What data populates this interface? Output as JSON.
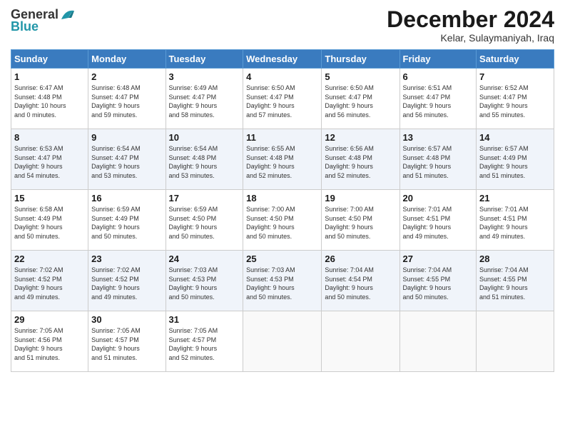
{
  "header": {
    "logo_general": "General",
    "logo_blue": "Blue",
    "month_title": "December 2024",
    "location": "Kelar, Sulaymaniyah, Iraq"
  },
  "calendar": {
    "days_of_week": [
      "Sunday",
      "Monday",
      "Tuesday",
      "Wednesday",
      "Thursday",
      "Friday",
      "Saturday"
    ],
    "weeks": [
      [
        {
          "day": "1",
          "info": "Sunrise: 6:47 AM\nSunset: 4:48 PM\nDaylight: 10 hours\nand 0 minutes."
        },
        {
          "day": "2",
          "info": "Sunrise: 6:48 AM\nSunset: 4:47 PM\nDaylight: 9 hours\nand 59 minutes."
        },
        {
          "day": "3",
          "info": "Sunrise: 6:49 AM\nSunset: 4:47 PM\nDaylight: 9 hours\nand 58 minutes."
        },
        {
          "day": "4",
          "info": "Sunrise: 6:50 AM\nSunset: 4:47 PM\nDaylight: 9 hours\nand 57 minutes."
        },
        {
          "day": "5",
          "info": "Sunrise: 6:50 AM\nSunset: 4:47 PM\nDaylight: 9 hours\nand 56 minutes."
        },
        {
          "day": "6",
          "info": "Sunrise: 6:51 AM\nSunset: 4:47 PM\nDaylight: 9 hours\nand 56 minutes."
        },
        {
          "day": "7",
          "info": "Sunrise: 6:52 AM\nSunset: 4:47 PM\nDaylight: 9 hours\nand 55 minutes."
        }
      ],
      [
        {
          "day": "8",
          "info": "Sunrise: 6:53 AM\nSunset: 4:47 PM\nDaylight: 9 hours\nand 54 minutes."
        },
        {
          "day": "9",
          "info": "Sunrise: 6:54 AM\nSunset: 4:47 PM\nDaylight: 9 hours\nand 53 minutes."
        },
        {
          "day": "10",
          "info": "Sunrise: 6:54 AM\nSunset: 4:48 PM\nDaylight: 9 hours\nand 53 minutes."
        },
        {
          "day": "11",
          "info": "Sunrise: 6:55 AM\nSunset: 4:48 PM\nDaylight: 9 hours\nand 52 minutes."
        },
        {
          "day": "12",
          "info": "Sunrise: 6:56 AM\nSunset: 4:48 PM\nDaylight: 9 hours\nand 52 minutes."
        },
        {
          "day": "13",
          "info": "Sunrise: 6:57 AM\nSunset: 4:48 PM\nDaylight: 9 hours\nand 51 minutes."
        },
        {
          "day": "14",
          "info": "Sunrise: 6:57 AM\nSunset: 4:49 PM\nDaylight: 9 hours\nand 51 minutes."
        }
      ],
      [
        {
          "day": "15",
          "info": "Sunrise: 6:58 AM\nSunset: 4:49 PM\nDaylight: 9 hours\nand 50 minutes."
        },
        {
          "day": "16",
          "info": "Sunrise: 6:59 AM\nSunset: 4:49 PM\nDaylight: 9 hours\nand 50 minutes."
        },
        {
          "day": "17",
          "info": "Sunrise: 6:59 AM\nSunset: 4:50 PM\nDaylight: 9 hours\nand 50 minutes."
        },
        {
          "day": "18",
          "info": "Sunrise: 7:00 AM\nSunset: 4:50 PM\nDaylight: 9 hours\nand 50 minutes."
        },
        {
          "day": "19",
          "info": "Sunrise: 7:00 AM\nSunset: 4:50 PM\nDaylight: 9 hours\nand 50 minutes."
        },
        {
          "day": "20",
          "info": "Sunrise: 7:01 AM\nSunset: 4:51 PM\nDaylight: 9 hours\nand 49 minutes."
        },
        {
          "day": "21",
          "info": "Sunrise: 7:01 AM\nSunset: 4:51 PM\nDaylight: 9 hours\nand 49 minutes."
        }
      ],
      [
        {
          "day": "22",
          "info": "Sunrise: 7:02 AM\nSunset: 4:52 PM\nDaylight: 9 hours\nand 49 minutes."
        },
        {
          "day": "23",
          "info": "Sunrise: 7:02 AM\nSunset: 4:52 PM\nDaylight: 9 hours\nand 49 minutes."
        },
        {
          "day": "24",
          "info": "Sunrise: 7:03 AM\nSunset: 4:53 PM\nDaylight: 9 hours\nand 50 minutes."
        },
        {
          "day": "25",
          "info": "Sunrise: 7:03 AM\nSunset: 4:53 PM\nDaylight: 9 hours\nand 50 minutes."
        },
        {
          "day": "26",
          "info": "Sunrise: 7:04 AM\nSunset: 4:54 PM\nDaylight: 9 hours\nand 50 minutes."
        },
        {
          "day": "27",
          "info": "Sunrise: 7:04 AM\nSunset: 4:55 PM\nDaylight: 9 hours\nand 50 minutes."
        },
        {
          "day": "28",
          "info": "Sunrise: 7:04 AM\nSunset: 4:55 PM\nDaylight: 9 hours\nand 51 minutes."
        }
      ],
      [
        {
          "day": "29",
          "info": "Sunrise: 7:05 AM\nSunset: 4:56 PM\nDaylight: 9 hours\nand 51 minutes."
        },
        {
          "day": "30",
          "info": "Sunrise: 7:05 AM\nSunset: 4:57 PM\nDaylight: 9 hours\nand 51 minutes."
        },
        {
          "day": "31",
          "info": "Sunrise: 7:05 AM\nSunset: 4:57 PM\nDaylight: 9 hours\nand 52 minutes."
        },
        {
          "day": "",
          "info": ""
        },
        {
          "day": "",
          "info": ""
        },
        {
          "day": "",
          "info": ""
        },
        {
          "day": "",
          "info": ""
        }
      ]
    ]
  }
}
